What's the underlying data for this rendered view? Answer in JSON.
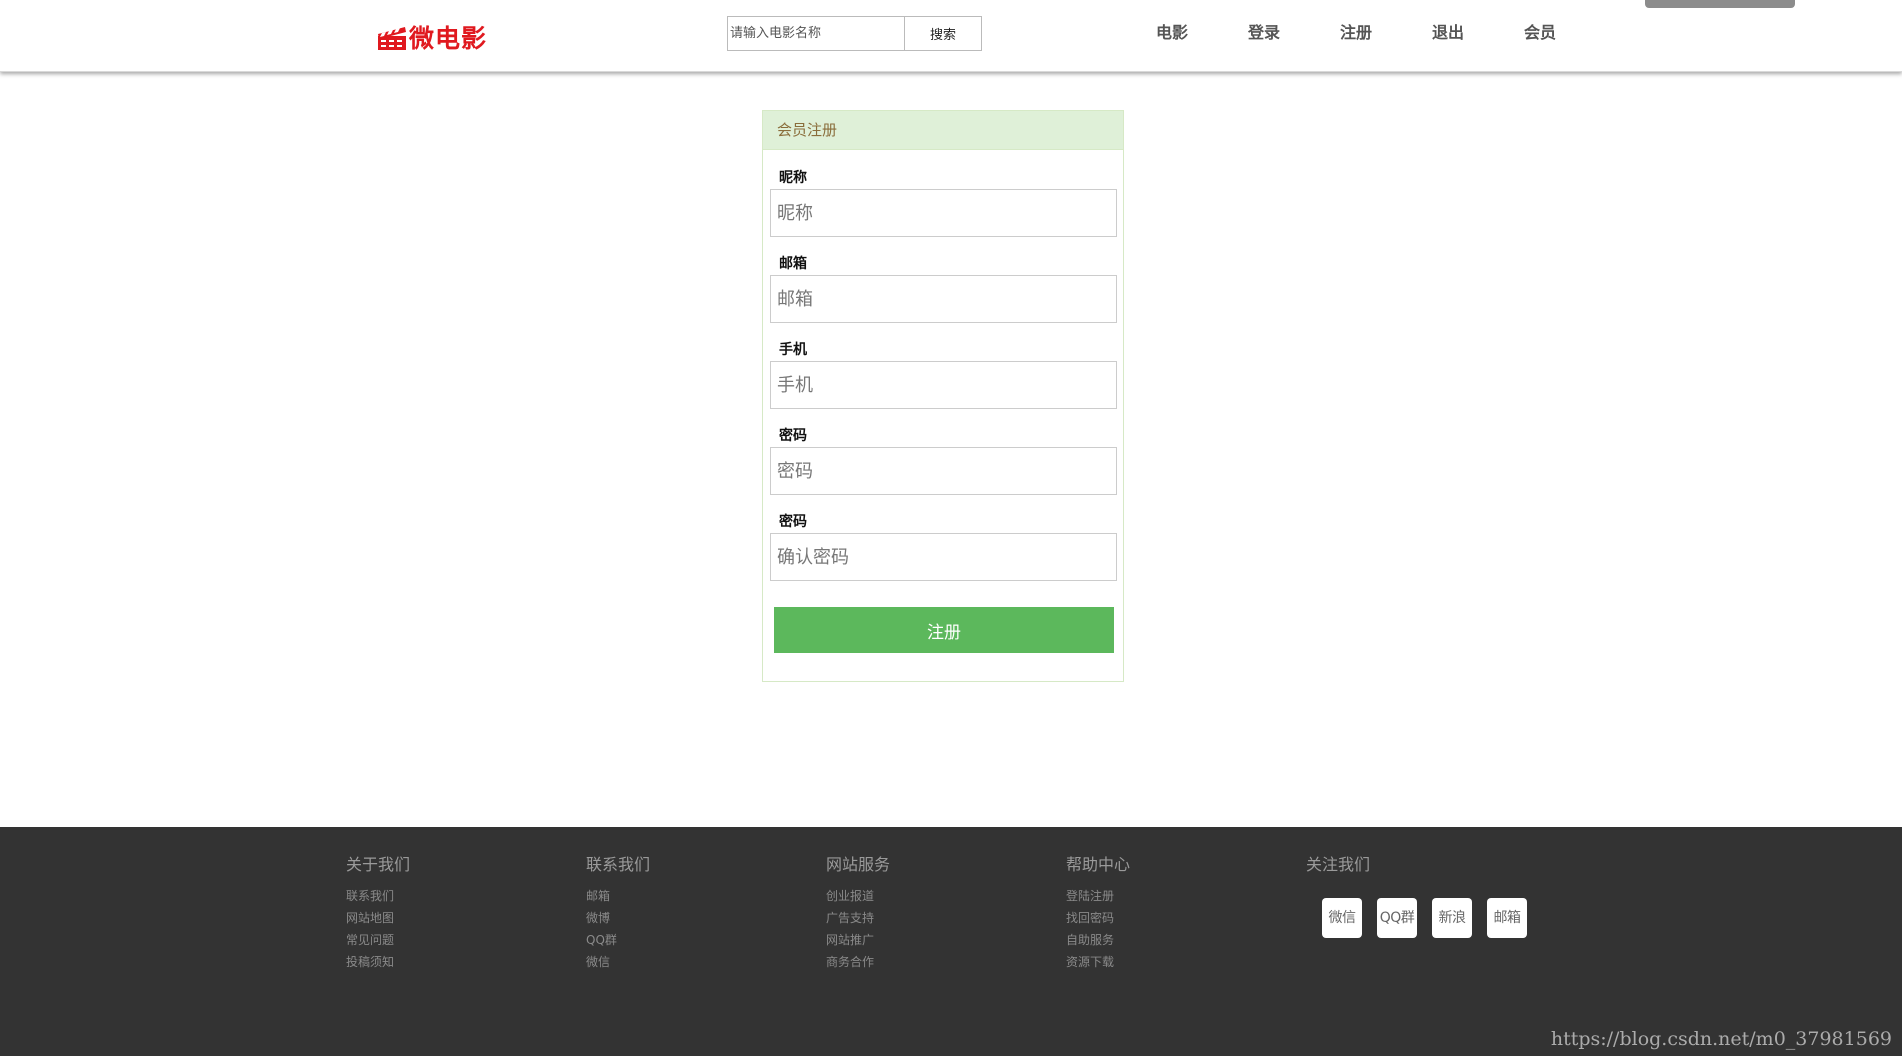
{
  "header": {
    "logo_text": "微电影",
    "search": {
      "placeholder": "请输入电影名称",
      "button_label": "搜索"
    },
    "nav": [
      {
        "label": "电影"
      },
      {
        "label": "登录"
      },
      {
        "label": "注册"
      },
      {
        "label": "退出"
      },
      {
        "label": "会员"
      }
    ]
  },
  "form": {
    "title": "会员注册",
    "fields": [
      {
        "label": "昵称",
        "placeholder": "昵称"
      },
      {
        "label": "邮箱",
        "placeholder": "邮箱"
      },
      {
        "label": "手机",
        "placeholder": "手机"
      },
      {
        "label": "密码",
        "placeholder": "密码"
      },
      {
        "label": "密码",
        "placeholder": "确认密码"
      }
    ],
    "submit_label": "注册"
  },
  "footer": {
    "columns": [
      {
        "title": "关于我们",
        "links": [
          "联系我们",
          "网站地图",
          "常见问题",
          "投稿须知"
        ]
      },
      {
        "title": "联系我们",
        "links": [
          "邮箱",
          "微博",
          "QQ群",
          "微信"
        ]
      },
      {
        "title": "网站服务",
        "links": [
          "创业报道",
          "广告支持",
          "网站推广",
          "商务合作"
        ]
      },
      {
        "title": "帮助中心",
        "links": [
          "登陆注册",
          "找回密码",
          "自助服务",
          "资源下载"
        ]
      }
    ],
    "follow": {
      "title": "关注我们",
      "buttons": [
        "微信",
        "QQ群",
        "新浪",
        "邮箱"
      ]
    }
  },
  "watermark": "https://blog.csdn.net/m0_37981569",
  "colors": {
    "logo": "#e0191f",
    "panel_heading_bg": "#dff0d8",
    "panel_heading_text": "#8a6d3b",
    "submit_bg": "#5cb85c",
    "footer_bg": "#333333"
  }
}
